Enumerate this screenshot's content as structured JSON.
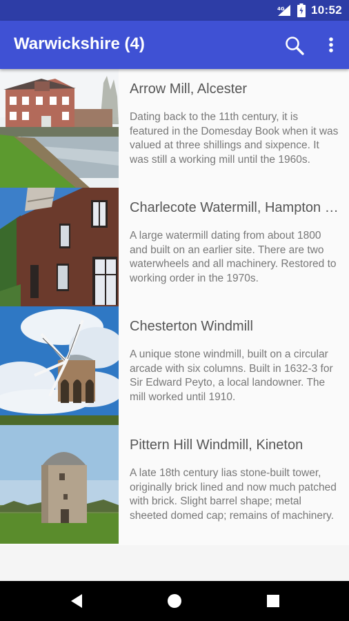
{
  "status_bar": {
    "network": "4G",
    "time": "10:52",
    "icons": [
      "signal-icon",
      "battery-icon"
    ]
  },
  "app_bar": {
    "title": "Warwickshire (4)",
    "icons": [
      "search-icon",
      "more-vert-icon"
    ]
  },
  "items": [
    {
      "name": "Arrow Mill, Alcester",
      "description": "Dating back to the 11th century, it is featured in the Domesday Book when it was valued at three shillings and sixpence. It was still a working mill until the 1960s."
    },
    {
      "name": "Charlecote Watermill, Hampton Lucy",
      "description": "A large watermill dating from about 1800 and built on an earlier site. There are two waterwheels and all machinery. Restored to working order in the 1970s."
    },
    {
      "name": "Chesterton Windmill",
      "description": "A unique stone windmill, built on a circular arcade with six columns. Built in 1632-3 for Sir Edward Peyto, a local landowner. The mill worked until 1910."
    },
    {
      "name": "Pittern Hill Windmill, Kineton",
      "description": "A late 18th century lias stone-built tower, originally brick lined and now much patched with brick. Slight barrel shape; metal sheeted domed cap; remains of machinery."
    }
  ],
  "nav_bar": {
    "icons": [
      "back-icon",
      "home-icon",
      "recents-icon"
    ]
  },
  "colors": {
    "status_bar": "#2d3da6",
    "app_bar": "#3f51d4",
    "list_bg": "#fafafa",
    "title_text": "#555555",
    "desc_text": "#777777"
  }
}
